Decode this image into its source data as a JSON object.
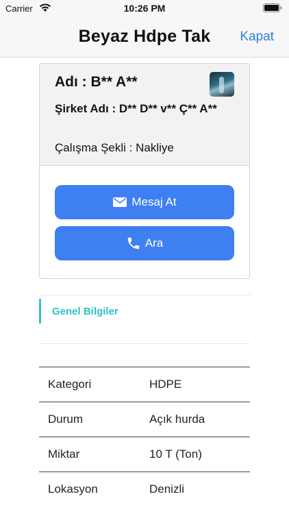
{
  "status_bar": {
    "carrier": "Carrier",
    "time": "10:26 PM"
  },
  "nav": {
    "title": "Beyaz Hdpe Tak",
    "close_label": "Kapat"
  },
  "seller": {
    "name": "Adı : B** A**",
    "company": "Şirket Adı : D** D** v** Ç** A**",
    "work_type": "Çalışma Şekli : Nakliye",
    "message_label": "Mesaj At",
    "call_label": "Ara"
  },
  "tabs": {
    "general": "Genel Bilgiler"
  },
  "info_rows": [
    {
      "key": "Kategori",
      "value": "HDPE"
    },
    {
      "key": "Durum",
      "value": "Açık hurda"
    },
    {
      "key": "Miktar",
      "value": "10 T (Ton)"
    },
    {
      "key": "Lokasyon",
      "value": "Denizli"
    }
  ],
  "colors": {
    "accent_blue": "#3e7ff2",
    "link_blue": "#2f7fdc",
    "tab_teal": "#2ec4c6"
  },
  "icons": {
    "message": "envelope-icon",
    "call": "phone-icon"
  }
}
